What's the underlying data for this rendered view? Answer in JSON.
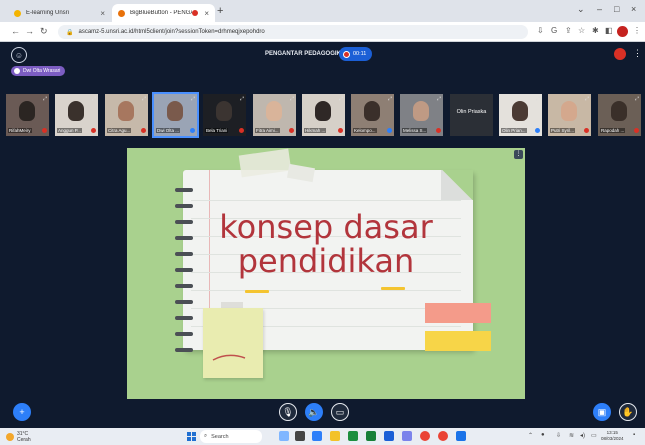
{
  "browser": {
    "tabs": [
      {
        "title": "E-learning Unsri",
        "favicon_color": "#f4b400",
        "active": false
      },
      {
        "title": "BigBlueButton - PENGANTAR",
        "favicon_color": "#e8710a",
        "active": true
      }
    ],
    "new_tab": "+",
    "url": "ascamz-5.unsri.ac.id/html5client/join?sessionToken=drhmeqjxepohdro"
  },
  "meeting": {
    "title": "PENGANTAR PEDAGOGIK",
    "recording_time": "00:11",
    "presenter": "Dwi Olta Wrasari",
    "participants": [
      {
        "name": "RifahMeiry",
        "mic": "muted",
        "bg": "#6a5a55",
        "head": "#2b2522"
      },
      {
        "name": "Anggun P...",
        "mic": "muted",
        "bg": "#d9d3cc",
        "head": "#3a312c"
      },
      {
        "name": "Citra Agu...",
        "mic": "muted",
        "bg": "#c6b9aa",
        "head": "#a7775f"
      },
      {
        "name": "Dwi Olta ...",
        "mic": "on",
        "bg": "#9aa4b5",
        "head": "#7a5a4c",
        "highlight": true
      },
      {
        "name": "Bela Triani",
        "mic": "muted",
        "bg": "#1d1f24",
        "head": "#3b3431"
      },
      {
        "name": "Fitra Aimi...",
        "mic": "muted",
        "bg": "#bfb7ae",
        "head": "#d9b49a"
      },
      {
        "name": "Hikmah ...",
        "mic": "muted",
        "bg": "#d6d0c8",
        "head": "#2f2826"
      },
      {
        "name": "Kelompo...",
        "mic": "on",
        "bg": "#8e7f74",
        "head": "#3a2f2a"
      },
      {
        "name": "Melissa S...",
        "mic": "muted",
        "bg": "#7f8186",
        "head": "#bf9a84"
      },
      {
        "name": "Olin Priaska",
        "mic": "none",
        "plain": true
      },
      {
        "name": "Olin Prian...",
        "mic": "on",
        "bg": "#e4e1dc",
        "head": "#4a3a33"
      },
      {
        "name": "Putri Syril...",
        "mic": "muted",
        "bg": "#c8b8a5",
        "head": "#d4a88d"
      },
      {
        "name": "Rapodah ...",
        "mic": "muted",
        "bg": "#6b5f56",
        "head": "#3a2f29"
      }
    ],
    "slide": {
      "line1": "konsep dasar",
      "line2": "pendidikan"
    }
  },
  "taskbar": {
    "weather_temp": "31°C",
    "weather_desc": "Cerah",
    "search_label": "Search",
    "time": "13:15",
    "date": "08/03/2024"
  }
}
